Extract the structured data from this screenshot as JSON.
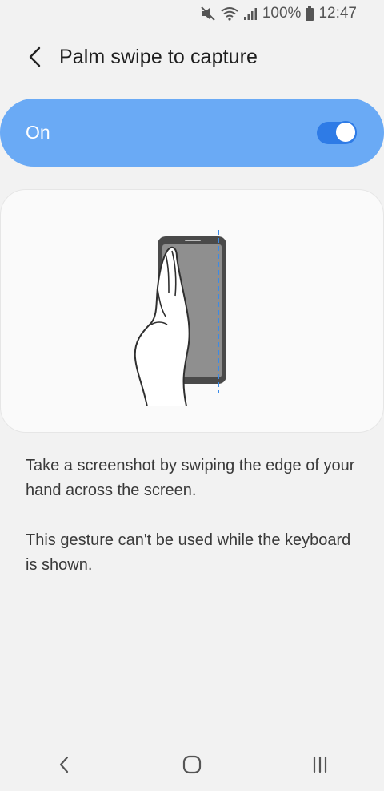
{
  "status_bar": {
    "battery_percent": "100%",
    "time": "12:47",
    "icons": [
      "mute-icon",
      "wifi-icon",
      "signal-icon",
      "battery-icon"
    ]
  },
  "header": {
    "title": "Palm swipe to capture",
    "back_icon": "back-arrow-icon"
  },
  "master_switch": {
    "label": "On",
    "checked": true,
    "accent_color": "#6aaaf5",
    "toggle_color": "#2e7be6"
  },
  "illustration": {
    "icon": "palm-swipe-illustration"
  },
  "description": {
    "line1": "Take a screenshot by swiping the edge of your hand across the screen.",
    "line2": "This gesture can't be used while the keyboard is shown."
  },
  "nav_bar": {
    "icons": [
      "nav-back-icon",
      "nav-home-icon",
      "nav-recents-icon"
    ]
  }
}
